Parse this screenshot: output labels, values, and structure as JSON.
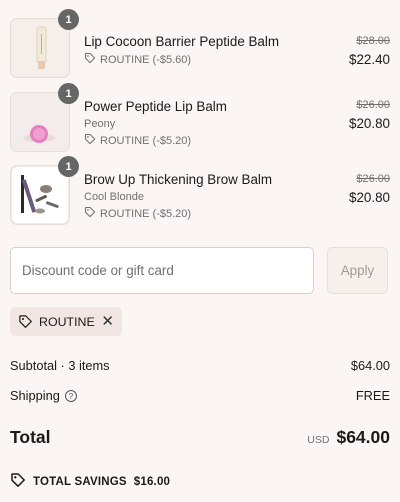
{
  "items": [
    {
      "name": "Lip Cocoon Barrier Peptide Balm",
      "variant": "",
      "discount": "ROUTINE (-$5.60)",
      "compare_price": "$28.00",
      "price": "$22.40",
      "qty": "1"
    },
    {
      "name": "Power Peptide Lip Balm",
      "variant": "Peony",
      "discount": "ROUTINE (-$5.20)",
      "compare_price": "$26.00",
      "price": "$20.80",
      "qty": "1"
    },
    {
      "name": "Brow Up Thickening Brow Balm",
      "variant": "Cool Blonde",
      "discount": "ROUTINE (-$5.20)",
      "compare_price": "$26.00",
      "price": "$20.80",
      "qty": "1"
    }
  ],
  "discount_form": {
    "placeholder": "Discount code or gift card",
    "apply_label": "Apply"
  },
  "applied_code": "ROUTINE",
  "summary": {
    "subtotal_label": "Subtotal · 3 items",
    "subtotal_value": "$64.00",
    "shipping_label": "Shipping",
    "shipping_value": "FREE",
    "total_label": "Total",
    "currency": "USD",
    "total_value": "$64.00",
    "savings_label": "TOTAL SAVINGS",
    "savings_value": "$16.00"
  },
  "colors": {
    "background": "#fbf6f4",
    "badge": "#666666",
    "chip": "#f1e6e2"
  },
  "icons": {
    "discount": "tag-icon",
    "remove": "close-icon",
    "help": "question-circle-icon",
    "savings": "savings-tag-icon"
  }
}
